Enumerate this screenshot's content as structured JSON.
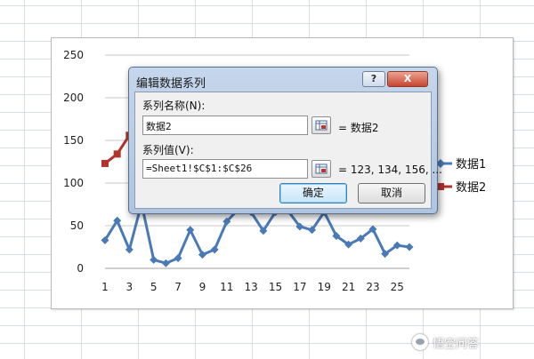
{
  "dialog": {
    "title": "编辑数据系列",
    "help_label": "?",
    "close_label": "X",
    "series_name_label": "系列名称(N):",
    "series_name_value": "数据2",
    "series_name_preview": "= 数据2",
    "series_values_label": "系列值(V):",
    "series_values_value": "=Sheet1!$C$1:$C$26",
    "series_values_preview": "= 123, 134, 156, ...",
    "ok_label": "确定",
    "cancel_label": "取消"
  },
  "watermark": {
    "text": "悟空问答"
  },
  "chart_data": {
    "type": "line",
    "x": [
      1,
      2,
      3,
      4,
      5,
      6,
      7,
      8,
      9,
      10,
      11,
      12,
      13,
      14,
      15,
      16,
      17,
      18,
      19,
      20,
      21,
      22,
      23,
      24,
      25,
      26
    ],
    "x_tick_labels": [
      "1",
      "3",
      "5",
      "7",
      "9",
      "11",
      "13",
      "15",
      "17",
      "19",
      "21",
      "23",
      "25"
    ],
    "ylim": [
      0,
      250
    ],
    "y_ticks": [
      0,
      50,
      100,
      150,
      200,
      250
    ],
    "grid": true,
    "legend_position": "right",
    "series": [
      {
        "name": "数据1",
        "color": "#4a7ab5",
        "marker": "diamond",
        "values": [
          33,
          56,
          22,
          76,
          10,
          6,
          12,
          45,
          16,
          22,
          55,
          70,
          66,
          44,
          66,
          68,
          49,
          45,
          66,
          38,
          28,
          35,
          46,
          17,
          27,
          25
        ]
      },
      {
        "name": "数据2",
        "color": "#b2322c",
        "marker": "square",
        "values": [
          123,
          134,
          156,
          160
        ]
      }
    ]
  }
}
